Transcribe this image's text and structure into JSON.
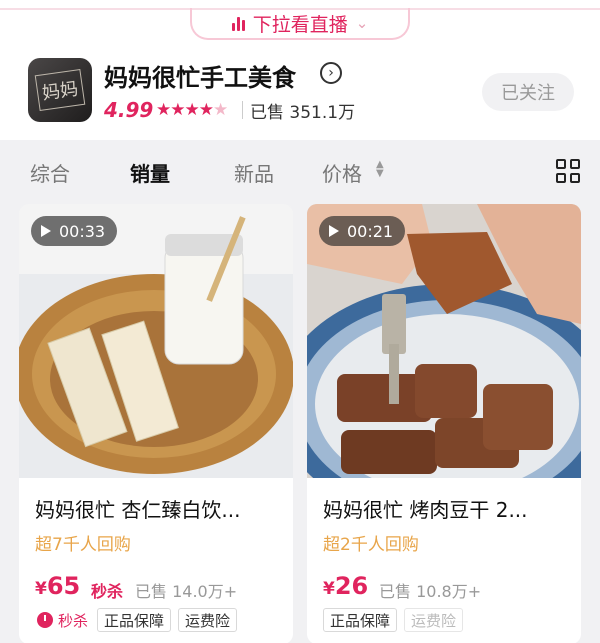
{
  "pull_bar": {
    "label": "下拉看直播"
  },
  "shop": {
    "logo_text": "妈妈",
    "name": "妈妈很忙手工美食",
    "rating": "4.99",
    "sold": "已售 351.1万",
    "follow_label": "已关注"
  },
  "tabs": [
    {
      "label": "综合"
    },
    {
      "label": "销量"
    },
    {
      "label": "新品"
    },
    {
      "label": "价格"
    }
  ],
  "active_tab": "销量",
  "products": [
    {
      "duration": "00:33",
      "title": "妈妈很忙 杏仁臻白饮...",
      "repurchase": "超7千人回购",
      "currency": "¥",
      "price": "65",
      "flash_label": "秒杀",
      "sold": "已售 14.0万+",
      "tags": [
        "秒杀",
        "正品保障",
        "运费险"
      ]
    },
    {
      "duration": "00:21",
      "title": "妈妈很忙 烤肉豆干  2...",
      "repurchase": "超2千人回购",
      "currency": "¥",
      "price": "26",
      "sold": "已售 10.8万+",
      "tags": [
        "正品保障",
        "运费险"
      ]
    }
  ],
  "colors": {
    "accent": "#e0245e",
    "repurchase": "#e8a54a",
    "background": "#f1f1f3"
  },
  "icons": [
    "live-bars-icon",
    "chevron-down-icon",
    "arrow-right-circle-icon",
    "star-icon",
    "sort-arrows-icon",
    "grid-view-icon",
    "play-icon",
    "flash-sale-icon"
  ]
}
